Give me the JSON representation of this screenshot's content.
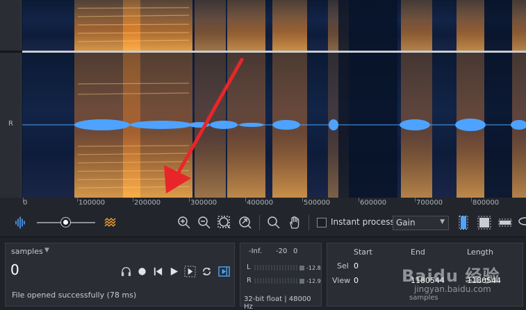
{
  "channel": {
    "label": "R"
  },
  "ruler": {
    "ticks": [
      "0",
      "100000",
      "200000",
      "300000",
      "400000",
      "500000",
      "600000",
      "700000",
      "800000"
    ]
  },
  "toolbar": {
    "instant_process_label": "Instant process",
    "gain_value": "Gain"
  },
  "transport": {
    "time_format": "samples",
    "time_value": "0",
    "status": "File opened successfully (78 ms)"
  },
  "meter": {
    "scale": [
      "-Inf.",
      "-20",
      "0"
    ],
    "left_label": "L",
    "right_label": "R",
    "left_peak": "-12.8",
    "right_peak": "-12.9",
    "format": "32-bit float | 48000 Hz"
  },
  "selection": {
    "headers": {
      "start": "Start",
      "end": "End",
      "length": "Length"
    },
    "rows": [
      {
        "label": "Sel",
        "start": "0",
        "end": "",
        "length": ""
      },
      {
        "label": "View",
        "start": "0",
        "end": "1180544",
        "length": "1180544"
      }
    ],
    "units": "samples"
  },
  "watermark": {
    "top": "Baidu 经验",
    "bottom": "jingyan.baidu.com"
  },
  "colors": {
    "accent": "#4da3ff",
    "spectrogram_hot": "#f08a2a",
    "arrow": "#e8262a",
    "background": "#1c1f24"
  }
}
